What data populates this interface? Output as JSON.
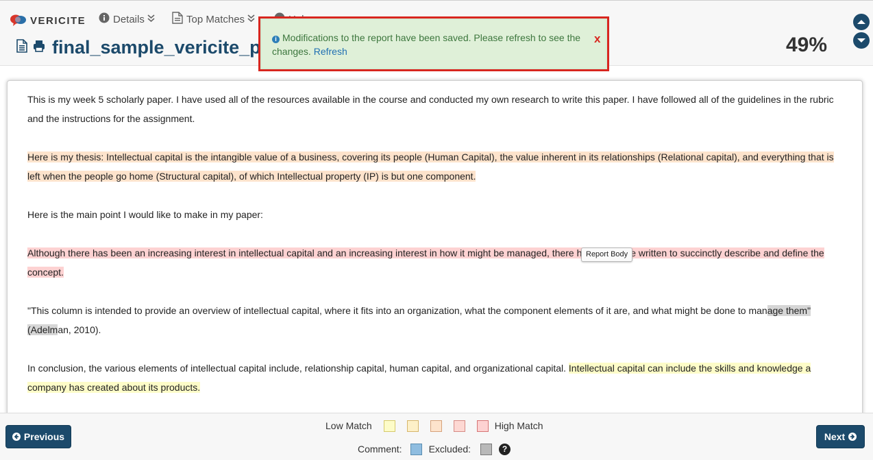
{
  "app": {
    "logo_text": "VERICITE"
  },
  "nav": {
    "details_label": "Details",
    "top_matches_label": "Top Matches",
    "help_label": "Help"
  },
  "document": {
    "title": "final_sample_vericite_paper",
    "match_percent": "49%"
  },
  "alert": {
    "message": "Modifications to the report have been saved. Please refresh to see the changes.",
    "link_label": "Refresh",
    "close_label": "x"
  },
  "report": {
    "p1": "This is my week 5 scholarly paper.   I have used all of the resources available in the course and conducted my own research to write this paper.     I have followed all of the guidelines in the rubric and the instructions for the assignment.",
    "p2": "Here is my thesis: Intellectual capital is the intangible value of a business, covering its people (Human Capital), the value inherent in its relationships (Relational capital), and everything that is left when the people go home (Structural capital), of which Intellectual property (IP) is but one component.",
    "p3": "Here is the main point I would like to make in my paper:",
    "p4": "Although there has been an increasing interest in intellectual capital and an increasing interest in how it might be managed, there has been little written to succinctly describe and define the concept.",
    "p5_a": " \"This column is intended to provide an overview of intellectual capital, where it fits into an organization, what the component elements of it are, and what might be done to man",
    "p5_b": "age them\" (Adelm",
    "p5_c": "an, 2010).",
    "p6_a": "In conclusion, the various elements of intellectual capital include, relationship capital, human capital, and organizational capital.  ",
    "p6_b": "Intellectual capital can include the skills and knowledge a company has created about its products.",
    "tooltip": "Report Body"
  },
  "footer": {
    "prev_label": "Previous",
    "next_label": "Next",
    "low_match_label": "Low Match",
    "high_match_label": "High Match",
    "comment_label": "Comment:",
    "excluded_label": "Excluded:"
  },
  "colors": {
    "brand": "#1c4a6b",
    "alert_border": "#d8261f",
    "alert_bg": "#dff0d8",
    "match_scale": [
      "#fdfcc8",
      "#fdf0c8",
      "#fde3cc",
      "#fdd8d3",
      "#fdd2d2"
    ],
    "comment": "#8fbde0",
    "excluded": "#b9b9b9"
  }
}
